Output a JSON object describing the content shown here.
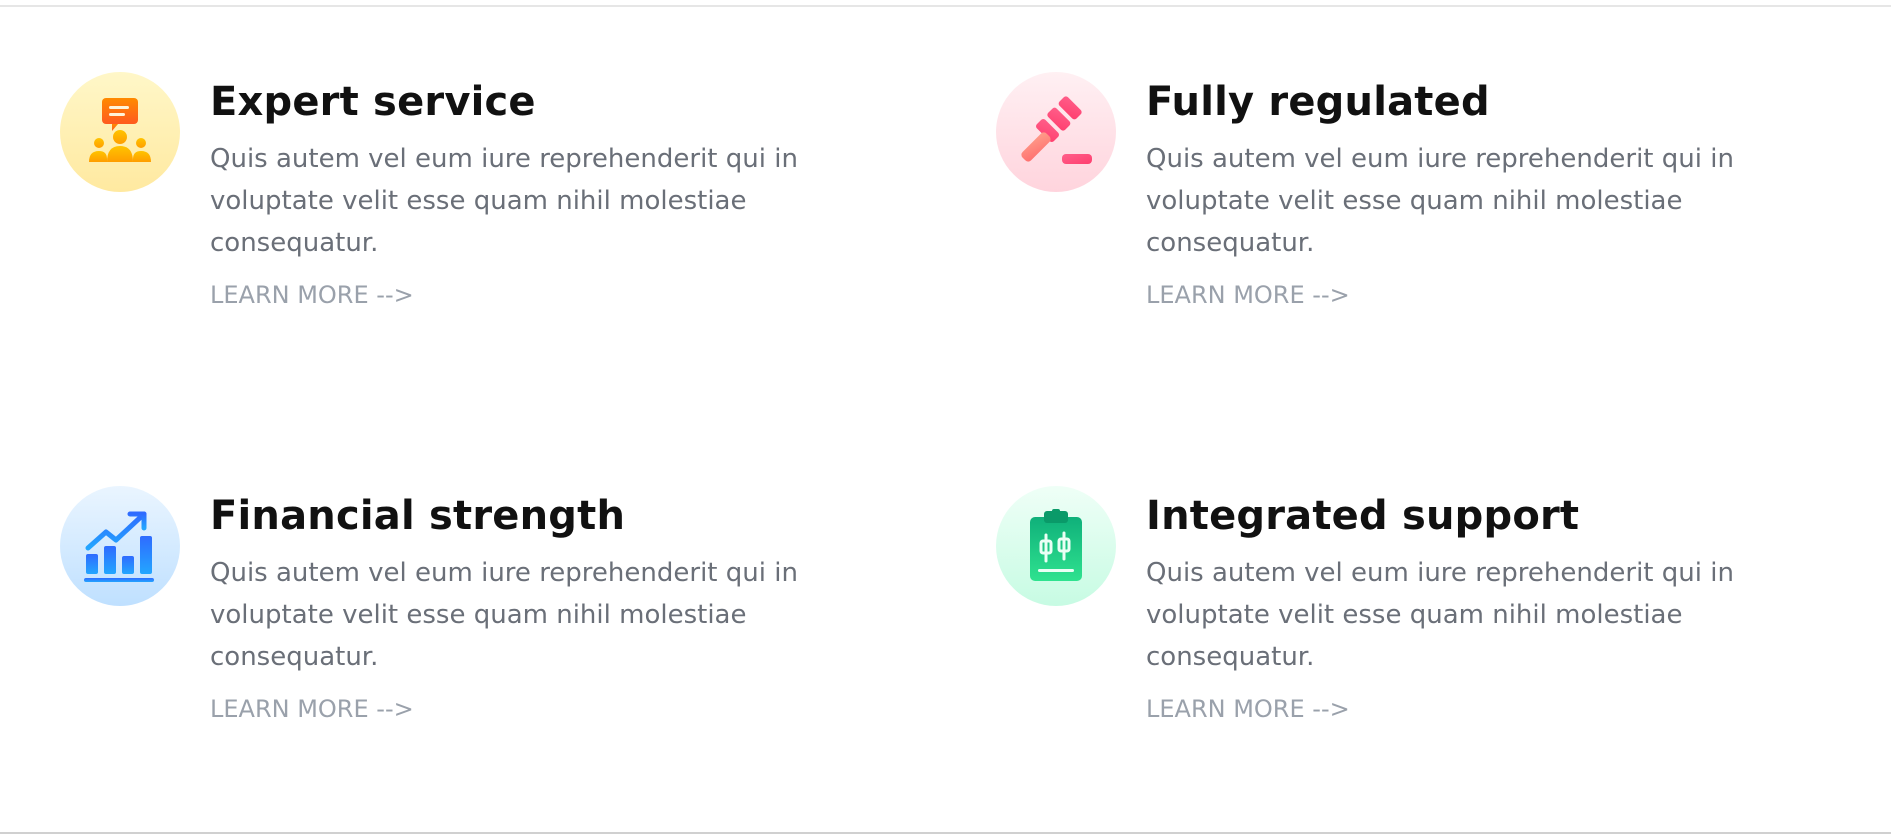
{
  "features": [
    {
      "title": "Expert service",
      "description": "Quis autem vel eum iure reprehenderit qui in voluptate velit esse quam nihil molestiae consequatur.",
      "link_label": "LEARN MORE -->",
      "icon": "expert-team-icon",
      "accent": "#ffd84a"
    },
    {
      "title": "Fully regulated",
      "description": "Quis autem vel eum iure reprehenderit qui in voluptate velit esse quam nihil molestiae consequatur.",
      "link_label": "LEARN MORE -->",
      "icon": "gavel-icon",
      "accent": "#ff6b8e"
    },
    {
      "title": "Financial strength",
      "description": "Quis autem vel eum iure reprehenderit qui in voluptate velit esse quam nihil molestiae consequatur.",
      "link_label": "LEARN MORE -->",
      "icon": "growth-chart-icon",
      "accent": "#2f8dff"
    },
    {
      "title": "Integrated support",
      "description": "Quis autem vel eum iure reprehenderit qui in voluptate velit esse quam nihil molestiae consequatur.",
      "link_label": "LEARN MORE -->",
      "icon": "clipboard-chart-icon",
      "accent": "#22d38a"
    }
  ]
}
